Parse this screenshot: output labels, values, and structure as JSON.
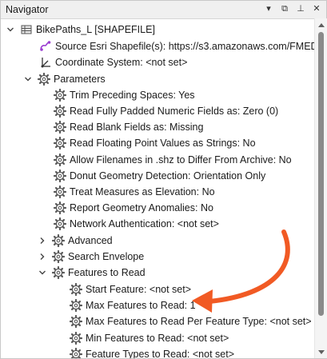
{
  "window": {
    "title": "Navigator",
    "buttons": {
      "dropdown_glyph": "▾",
      "float_glyph": "⧉",
      "pin_glyph": "⊥",
      "close_glyph": "✕"
    }
  },
  "tree": {
    "root": {
      "label": "BikePaths_L [SHAPEFILE]"
    },
    "source": {
      "label": "Source Esri Shapefile(s): https://s3.amazonaws.com/FMED..."
    },
    "coordsys": {
      "label": "Coordinate System: <not set>"
    },
    "parameters": {
      "label": "Parameters",
      "items": [
        "Trim Preceding Spaces: Yes",
        "Read Fully Padded Numeric Fields as: Zero (0)",
        "Read Blank Fields as: Missing",
        "Read Floating Point Values as Strings: No",
        "Allow Filenames in .shz to Differ From Archive: No",
        "Donut Geometry Detection: Orientation Only",
        "Treat Measures as Elevation: No",
        "Report Geometry Anomalies: No",
        "Network Authentication: <not set>"
      ],
      "advanced": {
        "label": "Advanced"
      },
      "search_envelope": {
        "label": "Search Envelope"
      },
      "features_to_read": {
        "label": "Features to Read",
        "items": [
          "Start Feature: <not set>",
          "Max Features to Read: 1",
          "Max Features to Read Per Feature Type: <not set>",
          "Min Features to Read: <not set>",
          "Feature Types to Read: <not set>"
        ]
      }
    }
  },
  "colors": {
    "annotation_arrow": "#f15a24",
    "source_icon": "#9b3fd1",
    "gear_icon": "#5a5a5a"
  },
  "icons": {
    "root": "layer-icon",
    "source": "link-icon",
    "coordsys": "axes-icon",
    "parameter": "gear-icon"
  }
}
